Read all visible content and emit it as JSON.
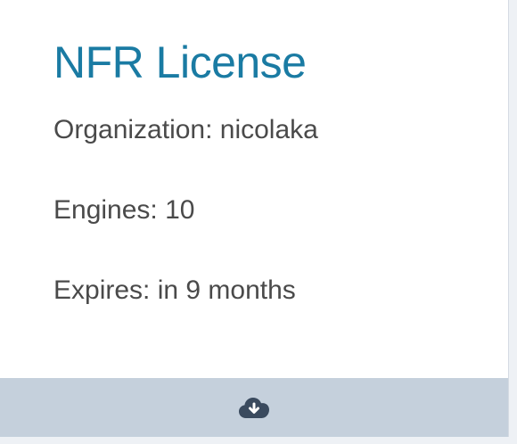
{
  "card": {
    "title": "NFR License",
    "title_color": "#1a7ba3",
    "organization": "Organization: nicolaka",
    "engines": "Engines: 10",
    "expires": "Expires: in 9 months"
  },
  "footer": {
    "icon": "cloud-download-icon",
    "icon_color": "#3a4a5e",
    "background": "#c5d0dc"
  }
}
